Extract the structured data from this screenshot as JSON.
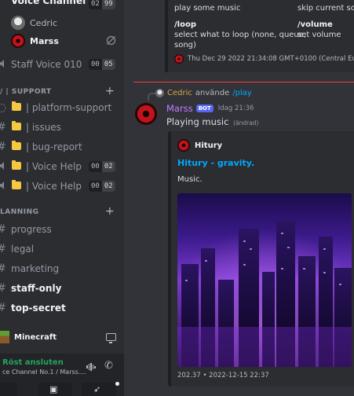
{
  "sidebar": {
    "voice_channel": {
      "name": "Voice Channel ...",
      "count_a": "02",
      "count_b": "99"
    },
    "voice_users": [
      {
        "name": "Cedric"
      },
      {
        "name": "Marss"
      }
    ],
    "staff_voice": {
      "name": "Staff Voice 010",
      "count_a": "00",
      "count_b": "05"
    },
    "category_support": "/ | SUPPORT",
    "support_channels": [
      {
        "name": "| platform-support"
      },
      {
        "name": "| issues"
      },
      {
        "name": "| bug-report"
      },
      {
        "name": "| Voice Help",
        "count_a": "00",
        "count_b": "02"
      },
      {
        "name": "| Voice Help",
        "count_a": "00",
        "count_b": "02"
      }
    ],
    "category_planning": "LANNING",
    "planning_channels": [
      {
        "name": "progress"
      },
      {
        "name": "legal"
      },
      {
        "name": "marketing"
      },
      {
        "name": "staff-only"
      },
      {
        "name": "top-secret"
      }
    ],
    "activity": {
      "name": "Minecraft"
    },
    "voice_status": {
      "status": "Röst ansluten",
      "subtitle": "ce Channel No.1 / Marss...."
    }
  },
  "top_embed": {
    "commands": [
      {
        "title": "",
        "desc": "play some music"
      },
      {
        "title": "",
        "desc": "skip current song"
      },
      {
        "title": "/loop",
        "desc": "select what to loop (none, queue,"
      },
      {
        "title": "/volume",
        "desc": "set volume"
      }
    ],
    "desc_cont": "song)",
    "footer": "Thu Dec 29 2022 21:34:08 GMT+0100 (Central European"
  },
  "reply": {
    "name": "Cedric",
    "text": "använde",
    "command": "/play"
  },
  "message": {
    "author": "Marss",
    "bot_tag": "BOT",
    "time": "Idag 21:36",
    "text": "Playing music",
    "edited": "(ändrad)"
  },
  "embed": {
    "author": "Hitury",
    "title": "Hitury - gravity.",
    "description": "Music.",
    "footer": "202.37 • 2022-12-15 22:37"
  },
  "colors": {
    "accent_bot": "#5865f2",
    "link": "#00a8fc",
    "voice_connected": "#23a55a",
    "divider_new": "#f23f43",
    "author_marss": "#c77dff",
    "author_cedric": "#e0a24a"
  }
}
